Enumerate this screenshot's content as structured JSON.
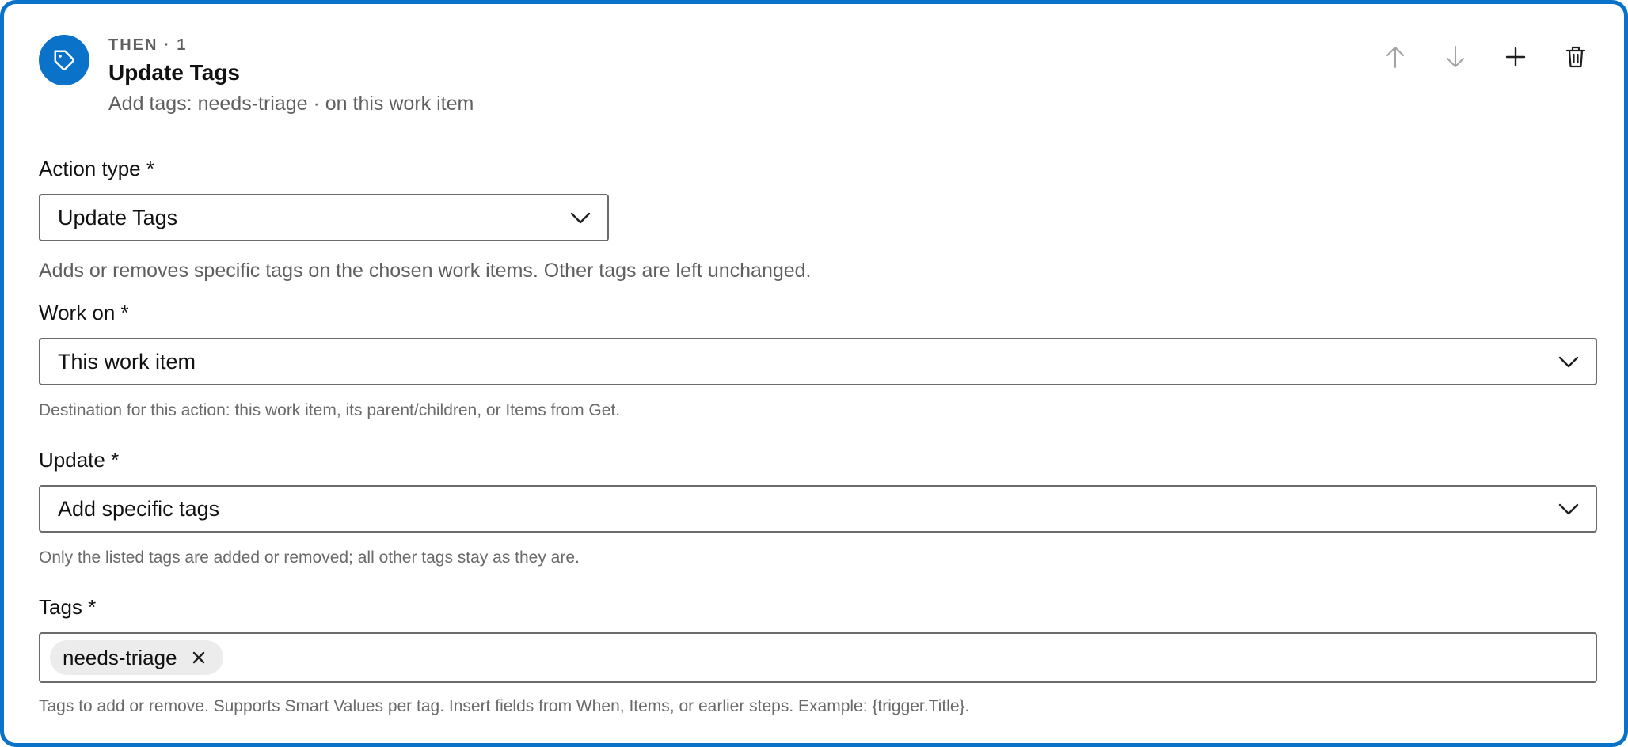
{
  "header": {
    "step_label": "THEN · 1",
    "title": "Update Tags",
    "summary": "Add tags: needs-triage · on this work item",
    "icon": "tag-icon"
  },
  "toolbar": {
    "move_up_icon": "arrow-up-icon",
    "move_down_icon": "arrow-down-icon",
    "add_icon": "plus-icon",
    "delete_icon": "trash-icon"
  },
  "action_type": {
    "label": "Action type *",
    "value": "Update Tags",
    "help": "Adds or removes specific tags on the chosen work items. Other tags are left unchanged."
  },
  "work_on": {
    "label": "Work on *",
    "value": "This work item",
    "help": "Destination for this action: this work item, its parent/children, or Items from Get."
  },
  "update": {
    "label": "Update *",
    "value": "Add specific tags",
    "help": "Only the listed tags are added or removed; all other tags stay as they are."
  },
  "tags": {
    "label": "Tags *",
    "items": [
      {
        "label": "needs-triage"
      }
    ],
    "help": "Tags to add or remove. Supports Smart Values per tag. Insert fields from When, Items, or earlier steps. Example: {trigger.Title}."
  },
  "colors": {
    "accent": "#0a72c9",
    "border": "#6b6b6b",
    "muted_text": "#5f5f5f",
    "chip_bg": "#ececec"
  }
}
